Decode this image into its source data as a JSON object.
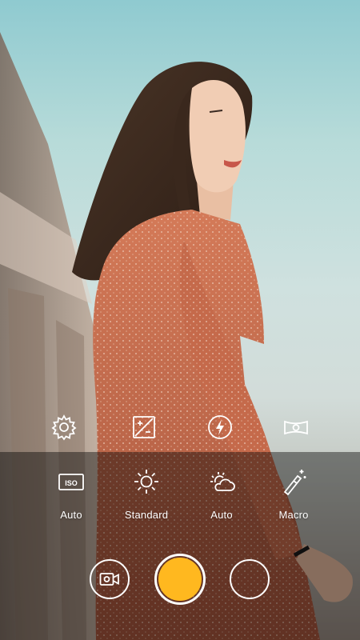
{
  "theme": {
    "shutter_color": "#FFB81F",
    "icon_color": "#ffffff",
    "panel_overlay": "rgba(0,0,0,0.42)"
  },
  "viewfinder": {
    "subject": "portrait-photo"
  },
  "top_controls": [
    {
      "icon": "settings-gear-icon"
    },
    {
      "icon": "exposure-icon"
    },
    {
      "icon": "flash-auto-icon"
    },
    {
      "icon": "panorama-icon"
    }
  ],
  "modes": [
    {
      "icon": "iso-icon",
      "label": "Auto"
    },
    {
      "icon": "brightness-sun-icon",
      "label": "Standard"
    },
    {
      "icon": "weather-partly-cloudy-icon",
      "label": "Auto"
    },
    {
      "icon": "magic-wand-icon",
      "label": "Macro"
    }
  ],
  "capture_bar": {
    "left_icon": "video-camera-icon",
    "center": "shutter-button",
    "right": "gallery-thumbnail"
  }
}
